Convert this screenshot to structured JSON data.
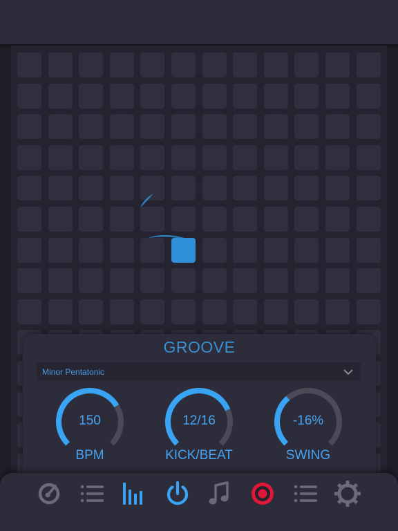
{
  "groove": {
    "title": "GROOVE",
    "scale": {
      "value": "Minor Pentatonic"
    },
    "knobs": [
      {
        "key": "bpm",
        "value": "150",
        "label": "BPM",
        "fill": 0.72
      },
      {
        "key": "kick",
        "value": "12/16",
        "label": "KICK/BEAT",
        "fill": 0.75
      },
      {
        "key": "swing",
        "value": "-16%",
        "label": "SWING",
        "fill": 0.35
      }
    ]
  },
  "grid": {
    "rows": 14,
    "cols": 12,
    "active": [
      [
        6,
        5
      ]
    ]
  },
  "nav": {
    "items": [
      {
        "icon": "speedometer-icon",
        "active": false
      },
      {
        "icon": "list-icon",
        "active": false
      },
      {
        "icon": "equalizer-bars-icon",
        "active": true
      },
      {
        "icon": "power-icon",
        "active": true
      },
      {
        "icon": "music-note-icon",
        "active": false
      },
      {
        "icon": "record-icon",
        "active": false
      },
      {
        "icon": "list-icon",
        "active": false
      },
      {
        "icon": "gear-icon",
        "active": false
      }
    ]
  },
  "colors": {
    "accent": "#3aa4f4",
    "background": "#1e1e27",
    "panel": "#2d2c3a",
    "cell": "#302f3d",
    "cell_active": "#2f8fd8",
    "icon_inactive": "#6b6a79",
    "record": "#e01838"
  }
}
